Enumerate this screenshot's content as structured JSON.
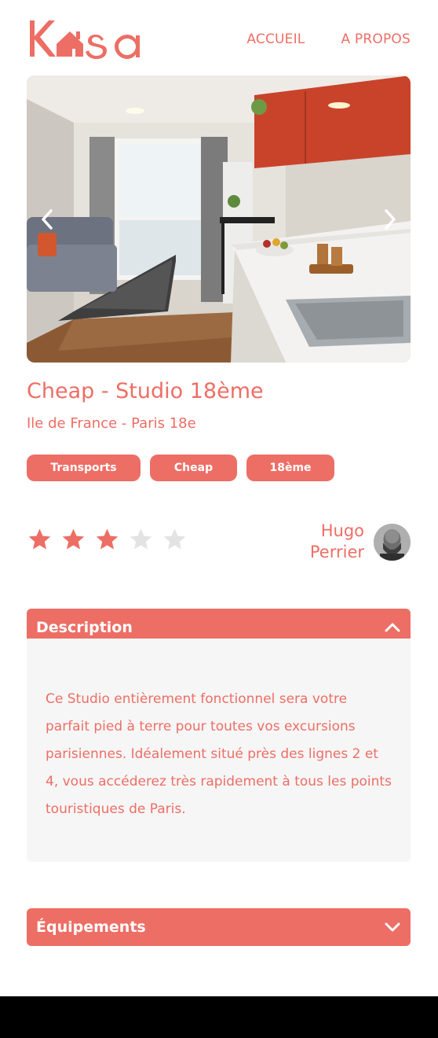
{
  "header": {
    "logo_text": "Kasa",
    "nav": [
      {
        "label": "ACCUEIL"
      },
      {
        "label": "A PROPOS"
      }
    ]
  },
  "gallery": {
    "image_alt": "Appartement studio",
    "prev_icon": "chevron-left-icon",
    "next_icon": "chevron-right-icon"
  },
  "listing": {
    "title": "Cheap - Studio 18ème",
    "location": "Ile de France - Paris 18e",
    "tags": [
      "Transports",
      "Cheap",
      "18ème"
    ],
    "rating": 3,
    "rating_max": 5
  },
  "host": {
    "first_name": "Hugo",
    "last_name": "Perrier"
  },
  "collapses": {
    "description": {
      "title": "Description",
      "icon": "chevron-up-icon",
      "text": "Ce Studio entièrement fonctionnel sera votre parfait pied à terre pour toutes vos excursions parisiennes. Idéalement situé près des lignes 2 et 4, vous accéderez très rapidement à tous les points touristiques de Paris."
    },
    "equipments": {
      "title": "Équipements",
      "icon": "chevron-down-icon"
    }
  },
  "colors": {
    "primary": "#ED6E65",
    "star_off": "#E3E3E3",
    "panel_bg": "#F6F6F6",
    "footer_bg": "#000000"
  }
}
